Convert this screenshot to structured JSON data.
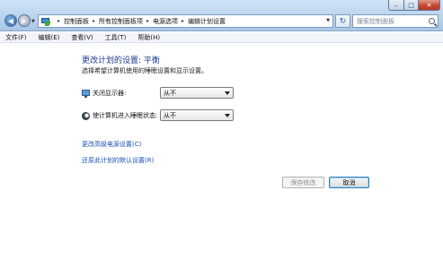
{
  "window": {
    "controls": {
      "minimize": "–",
      "maximize": "□",
      "close": "✕"
    },
    "back_glyph": "◀",
    "forward_glyph": "▶",
    "refresh_glyph": "↻"
  },
  "address": {
    "icon": "control-panel-icon",
    "crumbs": [
      "控制面板",
      "所有控制面板项",
      "电源选项",
      "编辑计划设置"
    ],
    "separator": "▸"
  },
  "search": {
    "placeholder": "搜索控制面板"
  },
  "menu": [
    "文件(F)",
    "编辑(E)",
    "查看(V)",
    "工具(T)",
    "帮助(H)"
  ],
  "main": {
    "title": "更改计划的设置: 平衡",
    "subtitle": "选择希望计算机使用的睡眠设置和显示设置。",
    "settings": [
      {
        "label": "关闭显示器:",
        "icon": "monitor-icon",
        "value": "从不"
      },
      {
        "label": "使计算机进入睡眠状态:",
        "icon": "sleep-moon-icon",
        "value": "从不"
      }
    ],
    "links": [
      "更改高级电源设置(C)",
      "还原此计划的默认设置(R)"
    ],
    "buttons": {
      "save": "保存修改",
      "cancel": "取消"
    }
  },
  "colors": {
    "title": "#1e3a8a",
    "link": "#1a4fb5",
    "accent": "#3c7fb1"
  }
}
